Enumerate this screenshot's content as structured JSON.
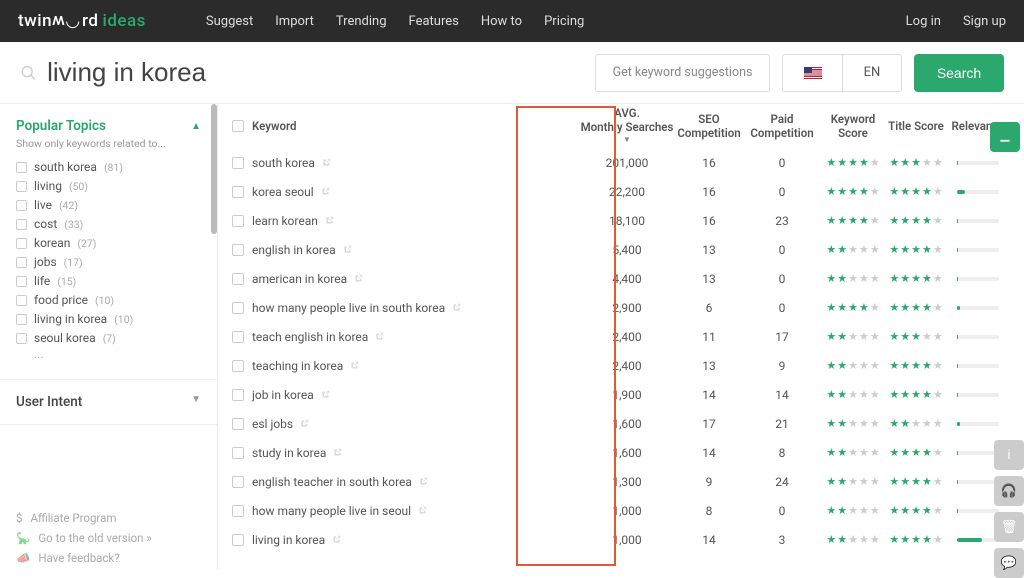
{
  "nav": {
    "logo_prefix": "twin",
    "logo_w": "w",
    "logo_suffix": "rd",
    "logo_ideas": "ideas",
    "links": [
      "Suggest",
      "Import",
      "Trending",
      "Features",
      "How to",
      "Pricing"
    ],
    "login": "Log in",
    "signup": "Sign up"
  },
  "search": {
    "query": "living in korea",
    "suggest_label": "Get keyword suggestions",
    "lang": "EN",
    "button": "Search"
  },
  "sidebar": {
    "popular_title": "Popular Topics",
    "popular_sub": "Show only keywords related to...",
    "topics": [
      {
        "label": "south korea",
        "count": "(81)"
      },
      {
        "label": "living",
        "count": "(50)"
      },
      {
        "label": "live",
        "count": "(42)"
      },
      {
        "label": "cost",
        "count": "(33)"
      },
      {
        "label": "korean",
        "count": "(27)"
      },
      {
        "label": "jobs",
        "count": "(17)"
      },
      {
        "label": "life",
        "count": "(15)"
      },
      {
        "label": "food price",
        "count": "(10)"
      },
      {
        "label": "living in korea",
        "count": "(10)"
      },
      {
        "label": "seoul korea",
        "count": "(7)"
      }
    ],
    "dots": "...",
    "intent_title": "User Intent",
    "footer": {
      "affiliate": "Affiliate Program",
      "old": "Go to the old version »",
      "feedback": "Have feedback?"
    }
  },
  "table": {
    "headers": {
      "keyword": "Keyword",
      "avg1": "AVG.",
      "avg2": "Monthly Searches",
      "seo": "SEO Competition",
      "paid": "Paid Competition",
      "kscore": "Keyword Score",
      "tscore": "Title Score",
      "rel": "Relevance"
    },
    "rows": [
      {
        "kw": "south korea",
        "avg": "201,000",
        "seo": "16",
        "paid": "0",
        "ks": 4,
        "ts": 3,
        "rel": 3
      },
      {
        "kw": "korea seoul",
        "avg": "22,200",
        "seo": "16",
        "paid": "0",
        "ks": 4,
        "ts": 4,
        "rel": 18
      },
      {
        "kw": "learn korean",
        "avg": "18,100",
        "seo": "16",
        "paid": "23",
        "ks": 4,
        "ts": 4,
        "rel": 3
      },
      {
        "kw": "english in korea",
        "avg": "5,400",
        "seo": "13",
        "paid": "0",
        "ks": 2,
        "ts": 4,
        "rel": 3
      },
      {
        "kw": "american in korea",
        "avg": "4,400",
        "seo": "13",
        "paid": "0",
        "ks": 2,
        "ts": 4,
        "rel": 3
      },
      {
        "kw": "how many people live in south korea",
        "avg": "2,900",
        "seo": "6",
        "paid": "0",
        "ks": 4,
        "ts": 4,
        "rel": 8
      },
      {
        "kw": "teach english in korea",
        "avg": "2,400",
        "seo": "11",
        "paid": "17",
        "ks": 2,
        "ts": 3,
        "rel": 3
      },
      {
        "kw": "teaching in korea",
        "avg": "2,400",
        "seo": "13",
        "paid": "9",
        "ks": 2,
        "ts": 4,
        "rel": 3
      },
      {
        "kw": "job in korea",
        "avg": "1,900",
        "seo": "14",
        "paid": "14",
        "ks": 2,
        "ts": 4,
        "rel": 3
      },
      {
        "kw": "esl jobs",
        "avg": "1,600",
        "seo": "17",
        "paid": "21",
        "ks": 2,
        "ts": 2,
        "rel": 8
      },
      {
        "kw": "study in korea",
        "avg": "1,600",
        "seo": "14",
        "paid": "8",
        "ks": 2,
        "ts": 4,
        "rel": 3
      },
      {
        "kw": "english teacher in south korea",
        "avg": "1,300",
        "seo": "9",
        "paid": "24",
        "ks": 2,
        "ts": 4,
        "rel": 3
      },
      {
        "kw": "how many people live in seoul",
        "avg": "1,000",
        "seo": "8",
        "paid": "0",
        "ks": 2,
        "ts": 4,
        "rel": 3
      },
      {
        "kw": "living in korea",
        "avg": "1,000",
        "seo": "14",
        "paid": "3",
        "ks": 2,
        "ts": 4,
        "rel": 60
      }
    ]
  }
}
